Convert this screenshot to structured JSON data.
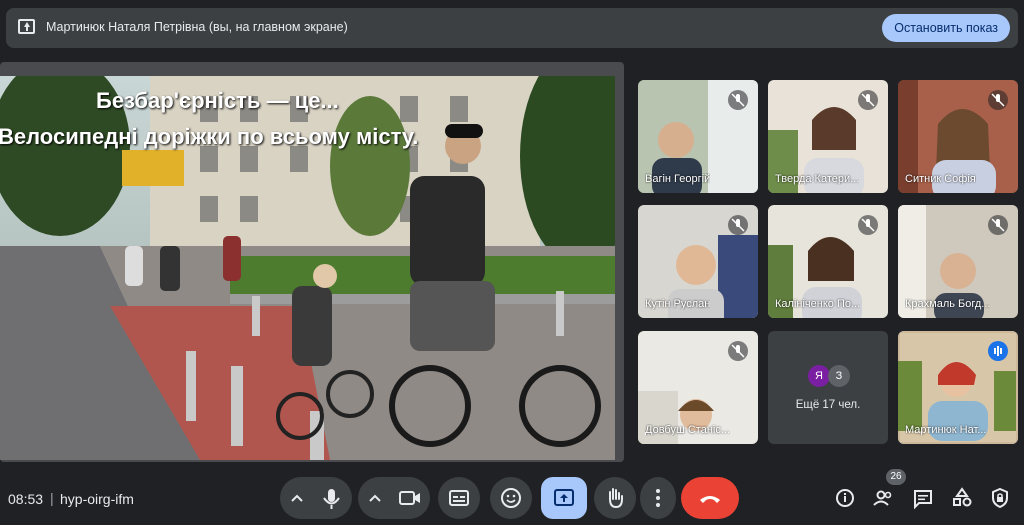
{
  "banner": {
    "presenter_text": "Мартинюк Наталя Петрівна (вы, на главном экране)",
    "stop_button": "Остановить показ"
  },
  "slide": {
    "line1": "Безбар'єрність — це...",
    "line2": "Велосипедні доріжки по всьому місту."
  },
  "participants": [
    {
      "name": "Вагін Георгій",
      "muted": true
    },
    {
      "name": "Тверда Катери...",
      "muted": true
    },
    {
      "name": "Ситник Софія",
      "muted": true
    },
    {
      "name": "Кутін Руслан",
      "muted": true
    },
    {
      "name": "Калініченко По...",
      "muted": true
    },
    {
      "name": "Крахмаль Богд...",
      "muted": true
    },
    {
      "name": "Довбуш Станіс...",
      "muted": true
    },
    {
      "name": "Мартинюк Нат...",
      "muted": false,
      "speaking": true
    }
  ],
  "more": {
    "avatars": [
      {
        "letter": "Я",
        "color": "#7b1fa2"
      },
      {
        "letter": "З",
        "color": "#5f6368"
      }
    ],
    "label": "Ещё 17 чел."
  },
  "bottom_bar": {
    "time": "08:53",
    "separator": "|",
    "meeting_code": "hyp-oirg-ifm",
    "people_count": "26"
  },
  "icons": {
    "share": "present-to-all-icon",
    "mic": "mic-icon",
    "camera": "videocam-icon",
    "captions": "closed-caption-icon",
    "emoji": "emoji-icon",
    "present": "present-screen-icon",
    "hand": "raise-hand-icon",
    "more": "more-vert-icon",
    "end": "end-call-icon",
    "info": "info-icon",
    "people": "people-icon",
    "chat": "chat-icon",
    "activities": "activities-icon",
    "host": "host-controls-icon"
  },
  "colors": {
    "background": "#202124",
    "accent": "#a8c7fa",
    "end_call": "#ea4335",
    "present_active": "#a8c7fa"
  }
}
